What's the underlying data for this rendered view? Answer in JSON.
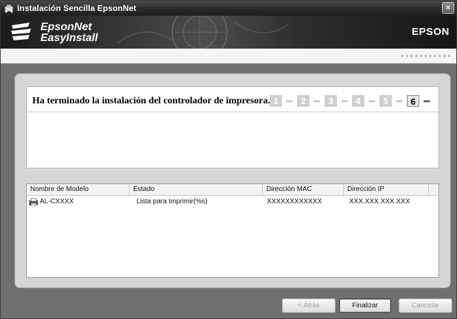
{
  "window": {
    "title": "Instalación Sencilla EpsonNet",
    "close_label": "×"
  },
  "banner": {
    "product_line1": "EpsonNet",
    "product_line2": "EasyInstall",
    "brand": "EPSON"
  },
  "strip": {
    "dots": "●●●●●●●●●●●"
  },
  "message": {
    "text": "Ha terminado la instalación del controlador de impresora."
  },
  "steps": [
    {
      "num": "1",
      "arrows": "▸▸▸",
      "active": false
    },
    {
      "num": "2",
      "arrows": "▸▸▸",
      "active": false
    },
    {
      "num": "3",
      "arrows": "▸▸▸",
      "active": false
    },
    {
      "num": "4",
      "arrows": "▸▸▸",
      "active": false
    },
    {
      "num": "5",
      "arrows": "▸▸▸",
      "active": false
    },
    {
      "num": "6",
      "arrows": "▸▸▸",
      "active": true
    }
  ],
  "table": {
    "columns": [
      "Nombre de Modelo",
      "Estado",
      "Dirección MAC",
      "Dirección IP"
    ],
    "rows": [
      {
        "model": "AL-CXXXX",
        "status": "Lista para Imprimir(%s)",
        "mac": "XXXXXXXXXXXX",
        "ip": "XXX.XXX.XXX.XXX"
      }
    ]
  },
  "buttons": {
    "back": "< Atrás",
    "finish": "Finalizar",
    "cancel": "Cancelar"
  },
  "icons": {
    "app": "network-printer-icon",
    "logo": "epsonnet-logo-icon",
    "printer": "printer-icon"
  }
}
